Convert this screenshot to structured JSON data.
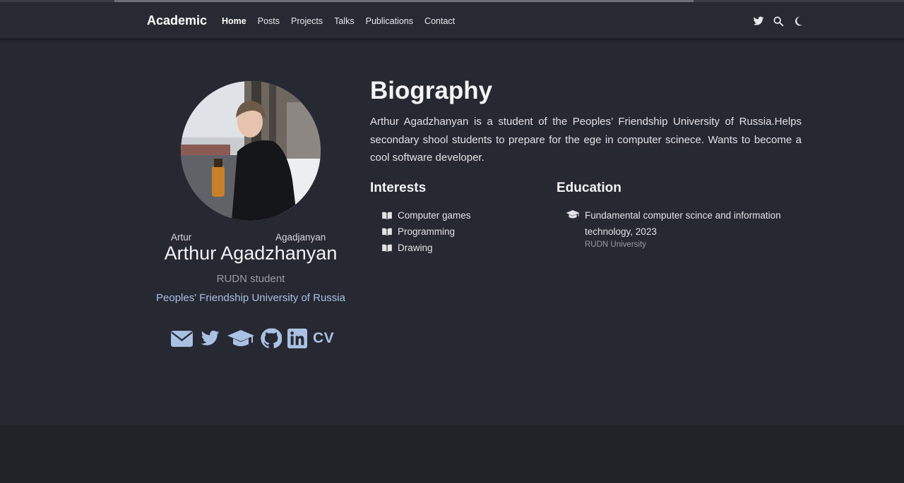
{
  "navbar": {
    "brand": "Academic",
    "links": [
      "Home",
      "Posts",
      "Projects",
      "Talks",
      "Publications",
      "Contact"
    ],
    "icons": [
      "twitter-icon",
      "search-icon",
      "moon-icon"
    ]
  },
  "profile": {
    "first_name": "Artur",
    "last_name": "Agadjanyan",
    "full_name": "Arthur Agadzhanyan",
    "role": "RUDN student",
    "organization": "Peoples' Friendship University of Russia",
    "social_icons": [
      "envelope-icon",
      "twitter-icon",
      "graduation-cap-icon",
      "github-icon",
      "linkedin-icon"
    ],
    "cv_label": "CV"
  },
  "biography": {
    "title": "Biography",
    "text": "Arthur Agadzhanyan is a student of the Peoples’ Friendship University of Russia.Helps secondary shool students to prepare for the ege in computer scinece. Wants to become a cool software developer."
  },
  "interests": {
    "title": "Interests",
    "items": [
      "Computer games",
      "Programming",
      "Drawing"
    ]
  },
  "education": {
    "title": "Education",
    "items": [
      {
        "course": "Fundamental computer scince and information technology, 2023",
        "institution": "RUDN University"
      }
    ]
  },
  "colors": {
    "background": "#262832",
    "navbar": "#282a33",
    "accent": "#a9c1e2",
    "text": "#e2e3e6",
    "muted": "#9a9ca3"
  }
}
